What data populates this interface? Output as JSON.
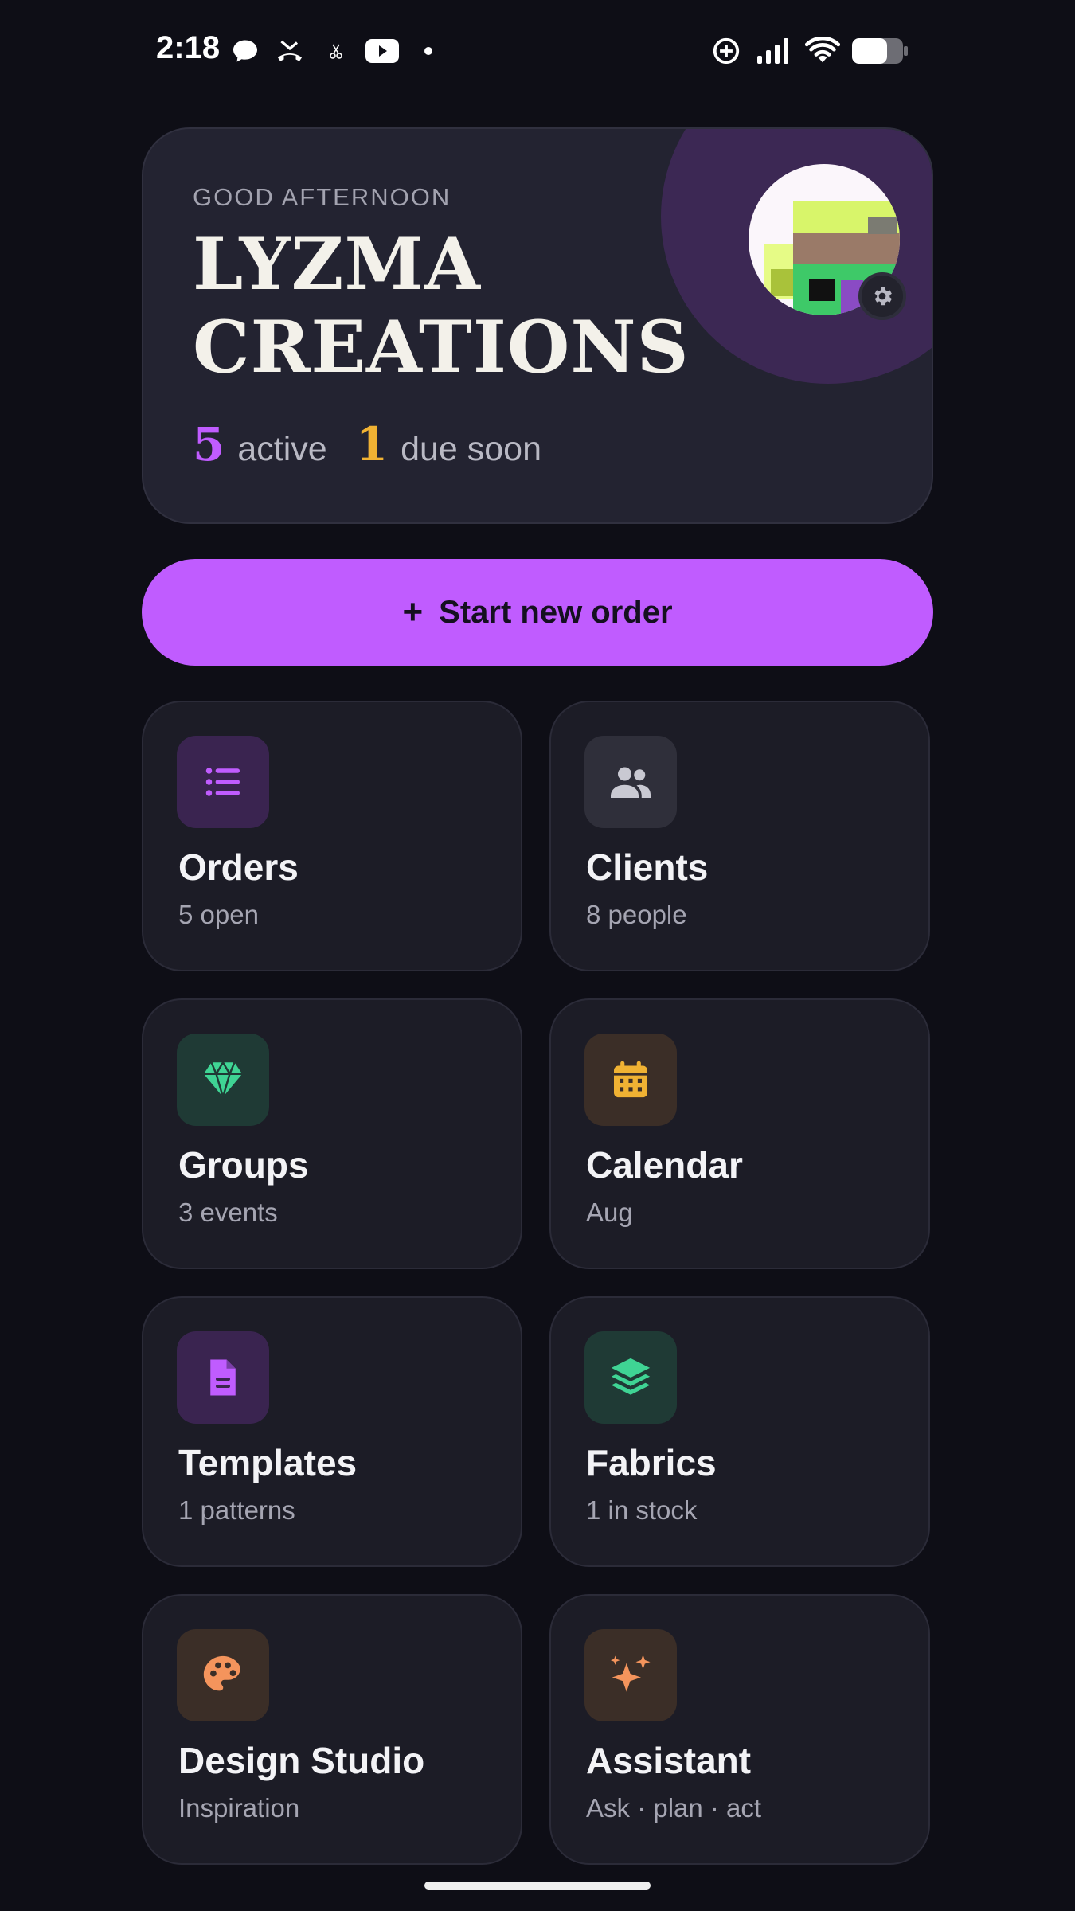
{
  "status_bar": {
    "time": "2:18",
    "left_icons": [
      "chat-bubble-icon",
      "missed-call-icon",
      "scissors-icon",
      "youtube-icon",
      "dot-icon"
    ],
    "right_icons": [
      "data-saver-icon",
      "signal-icon",
      "wifi-icon",
      "battery-icon"
    ]
  },
  "hero": {
    "greeting": "GOOD AFTERNOON",
    "brand_line1": "LYZMA",
    "brand_line2": "CREATIONS",
    "active_count": "5",
    "active_label": "active",
    "due_count": "1",
    "due_label": "due soon",
    "active_color": "#c05cff",
    "due_color": "#f0b233"
  },
  "cta": {
    "plus": "+",
    "label": "Start new order",
    "color": "#c05cff"
  },
  "tiles": [
    {
      "title": "Orders",
      "subtitle": "5 open",
      "icon": "list-icon",
      "icon_color": "#c05cff",
      "icon_bg": "#3a2450"
    },
    {
      "title": "Clients",
      "subtitle": "8 people",
      "icon": "people-icon",
      "icon_color": "#c9c9d2",
      "icon_bg": "#2f2f3a"
    },
    {
      "title": "Groups",
      "subtitle": "3 events",
      "icon": "diamond-icon",
      "icon_color": "#3fd494",
      "icon_bg": "#1f3a35"
    },
    {
      "title": "Calendar",
      "subtitle": "Aug",
      "icon": "calendar-icon",
      "icon_color": "#f0b233",
      "icon_bg": "#3b2e27"
    },
    {
      "title": "Templates",
      "subtitle": "1 patterns",
      "icon": "document-icon",
      "icon_color": "#c05cff",
      "icon_bg": "#3a2450"
    },
    {
      "title": "Fabrics",
      "subtitle": "1 in stock",
      "icon": "layers-icon",
      "icon_color": "#3fd494",
      "icon_bg": "#1f3a35"
    },
    {
      "title": "Design Studio",
      "subtitle": "Inspiration",
      "icon": "palette-icon",
      "icon_color": "#f4945c",
      "icon_bg": "#3b2e27"
    },
    {
      "title": "Assistant",
      "subtitle": "Ask · plan · act",
      "icon": "sparkle-icon",
      "icon_color": "#f4945c",
      "icon_bg": "#3b2e27"
    }
  ]
}
